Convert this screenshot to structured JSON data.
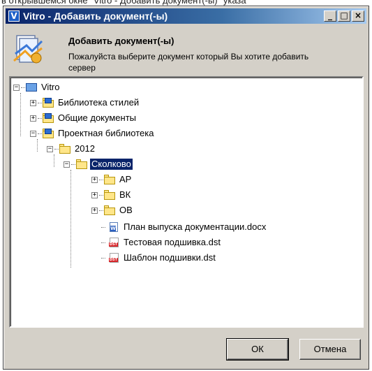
{
  "background_text": "в открывшемся окне \"Vitro - Добавить документ(-ы)\" указа",
  "window": {
    "title": "Vitro - Добавить документ(-ы)",
    "app_icon_glyph": "V",
    "buttons": {
      "minimize": "_",
      "maximize": "□",
      "close": "×"
    }
  },
  "header": {
    "title": "Добавить документ(-ы)",
    "description_line1": "Пожалуйста выберите документ который Вы хотите добавить",
    "description_line2": "сервер"
  },
  "tree": {
    "root": {
      "label": "Vitro",
      "expander": "−"
    },
    "libraries": [
      {
        "label": "Библиотека стилей",
        "expander": "+"
      },
      {
        "label": "Общие документы",
        "expander": "+"
      },
      {
        "label": "Проектная библиотека",
        "expander": "−"
      }
    ],
    "year": {
      "label": "2012",
      "expander": "−"
    },
    "selected": {
      "label": "Сколково",
      "expander": "−"
    },
    "subfolders": [
      {
        "label": "АР",
        "expander": "+"
      },
      {
        "label": "ВК",
        "expander": "+"
      },
      {
        "label": "ОВ",
        "expander": "+"
      }
    ],
    "files": [
      {
        "label": "План выпуска документации.docx",
        "type": "docx"
      },
      {
        "label": "Тестовая подшивка.dst",
        "type": "dst"
      },
      {
        "label": "Шаблон подшивки.dst",
        "type": "dst"
      }
    ]
  },
  "footer": {
    "ok_label": "ОК",
    "cancel_label": "Отмена"
  },
  "colors": {
    "titlebar_start": "#0a246a",
    "titlebar_end": "#a6caf0",
    "window_face": "#d4d0c8",
    "selection": "#0a246a",
    "folder": "#ffe68a"
  },
  "icons": {
    "header": "document-add-icon",
    "folder": "folder-icon",
    "library": "library-folder-icon",
    "docx": "word-document-icon",
    "dst": "dst-file-icon"
  }
}
